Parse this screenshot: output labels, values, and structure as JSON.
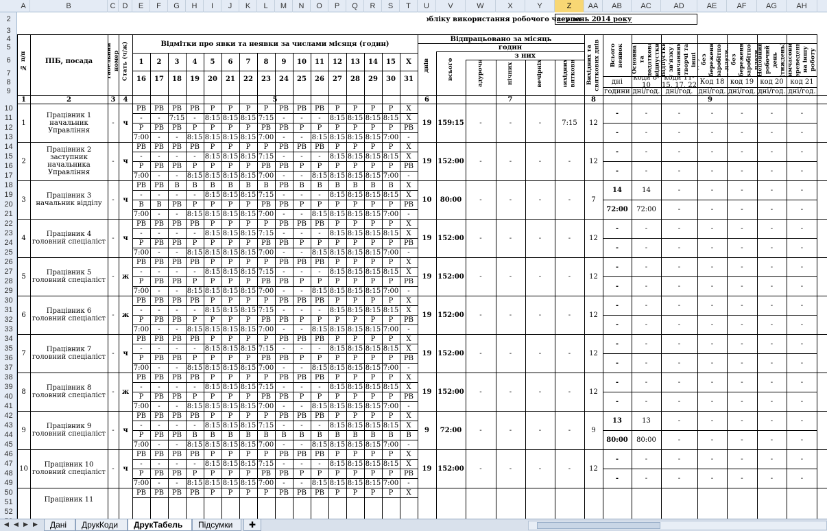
{
  "columns": [
    "A",
    "B",
    "C",
    "D",
    "E",
    "F",
    "G",
    "H",
    "I",
    "J",
    "K",
    "L",
    "M",
    "N",
    "O",
    "P",
    "Q",
    "R",
    "S",
    "T",
    "U",
    "V",
    "W",
    "X",
    "Y",
    "Z",
    "AA",
    "AB",
    "AC",
    "AD",
    "AE",
    "AF",
    "AG",
    "AH"
  ],
  "selected_column": "Z",
  "header": {
    "title_text": "обліку використання робочого часу за",
    "period": "серпень 2014 року",
    "no_label": "№ п/п",
    "name_label": "ПІБ, посада",
    "tab_label": "Табельний номер",
    "sex_label": "Стать (ч/ж)",
    "marks_label": "Відмітки  про явки та неявки за числами місяця (годин)",
    "days_top": [
      "1",
      "2",
      "3",
      "4",
      "5",
      "6",
      "7",
      "8",
      "9",
      "10",
      "11",
      "12",
      "13",
      "14",
      "15",
      "X"
    ],
    "days_bottom": [
      "16",
      "17",
      "18",
      "19",
      "20",
      "21",
      "22",
      "23",
      "24",
      "25",
      "26",
      "27",
      "28",
      "29",
      "30",
      "31"
    ],
    "worked_label": "Відпрацьовано за місяць",
    "hours_label": "годин",
    "of_them_label": "з них",
    "days_label": "днів",
    "total_label": "всього",
    "overtime_label": "надурочно",
    "night_label": "нічних",
    "evening_label": "вечірніх",
    "holiday_label": "вихідних, святкових",
    "holiday_days_label": "Вихідних та святкових днів",
    "total_absence_label": "Всього неявок",
    "reasons_label": "з причин за",
    "ab_days": "дні",
    "ab_hours": "години",
    "ac_text": "Основна та додаткова відпустки",
    "ac_code": "коди 8-10",
    "ac_unit": "дні/год.",
    "ad_text": "Відпустки у зв'язку з навчанням, творчі та інші",
    "ad_code": "коди 11-15, 17, 22",
    "ad_unit": "дні/год.",
    "ae_text": "Відпустки без збереження заробітної плати",
    "ae_code": "Код 18",
    "ae_unit": "дні/год.",
    "af_text": "Відпустки без збереження заробітної плати",
    "af_code": "код 19",
    "af_unit": "дні/год.",
    "ag_text": "Неповний робочий день (тиждень)",
    "ag_code": "код 20",
    "ag_unit": "дні/год.",
    "ah_text": "Тимчасовий переведення на іншу роботу",
    "ah_code": "код 21",
    "ah_unit": "дні/год.",
    "num_row": [
      "1",
      "2",
      "3",
      "4",
      "5",
      "6",
      "7",
      "8",
      "9"
    ]
  },
  "rows_top": [
    "1",
    "2",
    "3",
    "4",
    "5",
    "6",
    "7",
    "8",
    "9"
  ],
  "employees": [
    {
      "no": "1",
      "name": "Працівник 1",
      "pos": "начальник Управління",
      "sex": "ч",
      "tab": "-",
      "r1": [
        "РВ",
        "РВ",
        "РВ",
        "РВ",
        "Р",
        "Р",
        "Р",
        "Р",
        "РВ",
        "РВ",
        "РВ",
        "Р",
        "Р",
        "Р",
        "Р",
        "Х"
      ],
      "r2": [
        "-",
        "-",
        "7:15",
        "-",
        "8:15",
        "8:15",
        "8:15",
        "7:15",
        "-",
        "-",
        "-",
        "8:15",
        "8:15",
        "8:15",
        "8:15",
        "Х"
      ],
      "r3": [
        "Р",
        "РВ",
        "РВ",
        "Р",
        "Р",
        "Р",
        "Р",
        "РВ",
        "РВ",
        "Р",
        "Р",
        "Р",
        "Р",
        "Р",
        "Р",
        "РВ"
      ],
      "r4": [
        "7:00",
        "-",
        "-",
        "8:15",
        "8:15",
        "8:15",
        "8:15",
        "7:00",
        "-",
        "-",
        "8:15",
        "8:15",
        "8:15",
        "8:15",
        "7:00",
        "-"
      ],
      "days": "19",
      "total": "159:15",
      "ot": "-",
      "night": "-",
      "eve": "-",
      "hol": "7:15",
      "hold": "12",
      "abd": "-",
      "abh": "-",
      "acd": "-",
      "ach": "-"
    },
    {
      "no": "2",
      "name": "Працівник 2",
      "pos": "заступник начальника Управління",
      "sex": "ч",
      "tab": "-",
      "r1": [
        "РВ",
        "РВ",
        "РВ",
        "РВ",
        "Р",
        "Р",
        "Р",
        "Р",
        "РВ",
        "РВ",
        "РВ",
        "Р",
        "Р",
        "Р",
        "Р",
        "Х"
      ],
      "r2": [
        "-",
        "-",
        "-",
        "-",
        "8:15",
        "8:15",
        "8:15",
        "7:15",
        "-",
        "-",
        "-",
        "8:15",
        "8:15",
        "8:15",
        "8:15",
        "Х"
      ],
      "r3": [
        "Р",
        "РВ",
        "РВ",
        "Р",
        "Р",
        "Р",
        "Р",
        "РВ",
        "РВ",
        "Р",
        "Р",
        "Р",
        "Р",
        "Р",
        "Р",
        "РВ"
      ],
      "r4": [
        "7:00",
        "-",
        "-",
        "8:15",
        "8:15",
        "8:15",
        "8:15",
        "7:00",
        "-",
        "-",
        "8:15",
        "8:15",
        "8:15",
        "8:15",
        "7:00",
        "-"
      ],
      "days": "19",
      "total": "152:00",
      "ot": "-",
      "night": "-",
      "eve": "-",
      "hol": "-",
      "hold": "12",
      "abd": "-",
      "abh": "-",
      "acd": "-",
      "ach": "-"
    },
    {
      "no": "3",
      "name": "Працівник 3",
      "pos": "начальник відділу",
      "sex": "ч",
      "tab": "-",
      "r1": [
        "РВ",
        "РВ",
        "В",
        "В",
        "В",
        "В",
        "В",
        "В",
        "РВ",
        "В",
        "В",
        "В",
        "В",
        "В",
        "В",
        "Х"
      ],
      "r2": [
        "-",
        "-",
        "-",
        "-",
        "8:15",
        "8:15",
        "8:15",
        "7:15",
        "-",
        "-",
        "-",
        "8:15",
        "8:15",
        "8:15",
        "8:15",
        "Х"
      ],
      "r3": [
        "В",
        "В",
        "РВ",
        "Р",
        "Р",
        "Р",
        "Р",
        "РВ",
        "РВ",
        "Р",
        "Р",
        "Р",
        "Р",
        "Р",
        "Р",
        "РВ"
      ],
      "r4": [
        "7:00",
        "-",
        "-",
        "8:15",
        "8:15",
        "8:15",
        "8:15",
        "7:00",
        "-",
        "-",
        "8:15",
        "8:15",
        "8:15",
        "8:15",
        "7:00",
        "-"
      ],
      "days": "10",
      "total": "80:00",
      "ot": "-",
      "night": "-",
      "eve": "-",
      "hol": "-",
      "hold": "7",
      "abd": "14",
      "abh": "72:00",
      "acd": "14",
      "ach": "72:00"
    },
    {
      "no": "4",
      "name": "Працівник 4",
      "pos": "головний спеціаліст",
      "sex": "ч",
      "tab": "-",
      "r1": [
        "РВ",
        "РВ",
        "РВ",
        "РВ",
        "Р",
        "Р",
        "Р",
        "Р",
        "РВ",
        "РВ",
        "РВ",
        "Р",
        "Р",
        "Р",
        "Р",
        "Х"
      ],
      "r2": [
        "-",
        "-",
        "-",
        "-",
        "8:15",
        "8:15",
        "8:15",
        "7:15",
        "-",
        "-",
        "-",
        "8:15",
        "8:15",
        "8:15",
        "8:15",
        "Х"
      ],
      "r3": [
        "Р",
        "РВ",
        "РВ",
        "Р",
        "Р",
        "Р",
        "Р",
        "РВ",
        "РВ",
        "Р",
        "Р",
        "Р",
        "Р",
        "Р",
        "Р",
        "РВ"
      ],
      "r4": [
        "7:00",
        "-",
        "-",
        "8:15",
        "8:15",
        "8:15",
        "8:15",
        "7:00",
        "-",
        "-",
        "8:15",
        "8:15",
        "8:15",
        "8:15",
        "7:00",
        "-"
      ],
      "days": "19",
      "total": "152:00",
      "ot": "-",
      "night": "-",
      "eve": "-",
      "hol": "-",
      "hold": "12",
      "abd": "-",
      "abh": "-",
      "acd": "-",
      "ach": "-"
    },
    {
      "no": "5",
      "name": "Працівник 5",
      "pos": "головний спеціаліст",
      "sex": "ж",
      "tab": "-",
      "r1": [
        "РВ",
        "РВ",
        "РВ",
        "РВ",
        "Р",
        "Р",
        "Р",
        "Р",
        "РВ",
        "РВ",
        "РВ",
        "Р",
        "Р",
        "Р",
        "Р",
        "Х"
      ],
      "r2": [
        "-",
        "-",
        "-",
        "-",
        "8:15",
        "8:15",
        "8:15",
        "7:15",
        "-",
        "-",
        "-",
        "8:15",
        "8:15",
        "8:15",
        "8:15",
        "Х"
      ],
      "r3": [
        "Р",
        "РВ",
        "РВ",
        "Р",
        "Р",
        "Р",
        "Р",
        "РВ",
        "РВ",
        "Р",
        "Р",
        "Р",
        "Р",
        "Р",
        "Р",
        "РВ"
      ],
      "r4": [
        "7:00",
        "-",
        "-",
        "8:15",
        "8:15",
        "8:15",
        "8:15",
        "7:00",
        "-",
        "-",
        "8:15",
        "8:15",
        "8:15",
        "8:15",
        "7:00",
        "-"
      ],
      "days": "19",
      "total": "152:00",
      "ot": "-",
      "night": "-",
      "eve": "-",
      "hol": "-",
      "hold": "12",
      "abd": "-",
      "abh": "-",
      "acd": "-",
      "ach": "-"
    },
    {
      "no": "6",
      "name": "Працівник 6",
      "pos": "головний спеціаліст",
      "sex": "ж",
      "tab": "-",
      "r1": [
        "РВ",
        "РВ",
        "РВ",
        "РВ",
        "Р",
        "Р",
        "Р",
        "Р",
        "РВ",
        "РВ",
        "РВ",
        "Р",
        "Р",
        "Р",
        "Р",
        "Х"
      ],
      "r2": [
        "-",
        "-",
        "-",
        "-",
        "8:15",
        "8:15",
        "8:15",
        "7:15",
        "-",
        "-",
        "-",
        "8:15",
        "8:15",
        "8:15",
        "8:15",
        "Х"
      ],
      "r3": [
        "Р",
        "РВ",
        "РВ",
        "Р",
        "Р",
        "Р",
        "Р",
        "РВ",
        "РВ",
        "Р",
        "Р",
        "Р",
        "Р",
        "Р",
        "Р",
        "РВ"
      ],
      "r4": [
        "7:00",
        "-",
        "-",
        "8:15",
        "8:15",
        "8:15",
        "8:15",
        "7:00",
        "-",
        "-",
        "8:15",
        "8:15",
        "8:15",
        "8:15",
        "7:00",
        "-"
      ],
      "days": "19",
      "total": "152:00",
      "ot": "-",
      "night": "-",
      "eve": "-",
      "hol": "-",
      "hold": "12",
      "abd": "-",
      "abh": "-",
      "acd": "-",
      "ach": "-"
    },
    {
      "no": "7",
      "name": "Працівник 7",
      "pos": "головний спеціаліст",
      "sex": "ч",
      "tab": "-",
      "r1": [
        "РВ",
        "РВ",
        "РВ",
        "РВ",
        "Р",
        "Р",
        "Р",
        "Р",
        "РВ",
        "РВ",
        "РВ",
        "Р",
        "Р",
        "Р",
        "Р",
        "Х"
      ],
      "r2": [
        "-",
        "-",
        "-",
        "-",
        "8:15",
        "8:15",
        "8:15",
        "7:15",
        "-",
        "-",
        "-",
        "8:15",
        "8:15",
        "8:15",
        "8:15",
        "Х"
      ],
      "r3": [
        "Р",
        "РВ",
        "РВ",
        "Р",
        "Р",
        "Р",
        "Р",
        "РВ",
        "РВ",
        "Р",
        "Р",
        "Р",
        "Р",
        "Р",
        "Р",
        "РВ"
      ],
      "r4": [
        "7:00",
        "-",
        "-",
        "8:15",
        "8:15",
        "8:15",
        "8:15",
        "7:00",
        "-",
        "-",
        "8:15",
        "8:15",
        "8:15",
        "8:15",
        "7:00",
        "-"
      ],
      "days": "19",
      "total": "152:00",
      "ot": "-",
      "night": "-",
      "eve": "-",
      "hol": "-",
      "hold": "12",
      "abd": "-",
      "abh": "-",
      "acd": "-",
      "ach": "-"
    },
    {
      "no": "8",
      "name": "Працівник 8",
      "pos": "головний спеціаліст",
      "sex": "ж",
      "tab": "-",
      "r1": [
        "РВ",
        "РВ",
        "РВ",
        "РВ",
        "Р",
        "Р",
        "Р",
        "Р",
        "РВ",
        "РВ",
        "РВ",
        "Р",
        "Р",
        "Р",
        "Р",
        "Х"
      ],
      "r2": [
        "-",
        "-",
        "-",
        "-",
        "8:15",
        "8:15",
        "8:15",
        "7:15",
        "-",
        "-",
        "-",
        "8:15",
        "8:15",
        "8:15",
        "8:15",
        "Х"
      ],
      "r3": [
        "Р",
        "РВ",
        "РВ",
        "Р",
        "Р",
        "Р",
        "Р",
        "РВ",
        "РВ",
        "Р",
        "Р",
        "Р",
        "Р",
        "Р",
        "Р",
        "РВ"
      ],
      "r4": [
        "7:00",
        "-",
        "-",
        "8:15",
        "8:15",
        "8:15",
        "8:15",
        "7:00",
        "-",
        "-",
        "8:15",
        "8:15",
        "8:15",
        "8:15",
        "7:00",
        "-"
      ],
      "days": "19",
      "total": "152:00",
      "ot": "-",
      "night": "-",
      "eve": "-",
      "hol": "-",
      "hold": "12",
      "abd": "-",
      "abh": "-",
      "acd": "-",
      "ach": "-"
    },
    {
      "no": "9",
      "name": "Працівник 9",
      "pos": "головний спеціаліст",
      "sex": "ч",
      "tab": "-",
      "r1": [
        "РВ",
        "РВ",
        "РВ",
        "РВ",
        "Р",
        "Р",
        "Р",
        "Р",
        "РВ",
        "РВ",
        "РВ",
        "Р",
        "Р",
        "Р",
        "Р",
        "Х"
      ],
      "r2": [
        "-",
        "-",
        "-",
        "-",
        "8:15",
        "8:15",
        "8:15",
        "7:15",
        "-",
        "-",
        "-",
        "8:15",
        "8:15",
        "8:15",
        "8:15",
        "Х"
      ],
      "r3": [
        "Р",
        "РВ",
        "РВ",
        "В",
        "В",
        "В",
        "В",
        "В",
        "В",
        "В",
        "В",
        "В",
        "В",
        "В",
        "В",
        "В"
      ],
      "r4": [
        "7:00",
        "-",
        "-",
        "8:15",
        "8:15",
        "8:15",
        "8:15",
        "7:00",
        "-",
        "-",
        "8:15",
        "8:15",
        "8:15",
        "8:15",
        "7:00",
        "-"
      ],
      "days": "9",
      "total": "72:00",
      "ot": "-",
      "night": "-",
      "eve": "-",
      "hol": "-",
      "hold": "9",
      "abd": "13",
      "abh": "80:00",
      "acd": "13",
      "ach": "80:00"
    },
    {
      "no": "10",
      "name": "Працівник 10",
      "pos": "головний спеціаліст",
      "sex": "ч",
      "tab": "-",
      "r1": [
        "РВ",
        "РВ",
        "РВ",
        "РВ",
        "Р",
        "Р",
        "Р",
        "Р",
        "РВ",
        "РВ",
        "РВ",
        "Р",
        "Р",
        "Р",
        "Р",
        "Х"
      ],
      "r2": [
        "-",
        "-",
        "-",
        "-",
        "8:15",
        "8:15",
        "8:15",
        "7:15",
        "-",
        "-",
        "-",
        "8:15",
        "8:15",
        "8:15",
        "8:15",
        "Х"
      ],
      "r3": [
        "Р",
        "РВ",
        "РВ",
        "Р",
        "Р",
        "Р",
        "Р",
        "РВ",
        "РВ",
        "Р",
        "Р",
        "Р",
        "Р",
        "Р",
        "Р",
        "РВ"
      ],
      "r4": [
        "7:00",
        "-",
        "-",
        "8:15",
        "8:15",
        "8:15",
        "8:15",
        "7:00",
        "-",
        "-",
        "8:15",
        "8:15",
        "8:15",
        "8:15",
        "7:00",
        "-"
      ],
      "days": "19",
      "total": "152:00",
      "ot": "-",
      "night": "-",
      "eve": "-",
      "hol": "-",
      "hold": "12",
      "abd": "-",
      "abh": "-",
      "acd": "-",
      "ach": "-"
    }
  ],
  "partial": {
    "name": "Працівник 11",
    "r1": [
      "РВ",
      "РВ",
      "РВ",
      "РВ",
      "Р",
      "Р",
      "Р",
      "Р",
      "РВ",
      "РВ",
      "РВ",
      "Р",
      "Р",
      "Р",
      "Р",
      "Х"
    ]
  },
  "tabs": [
    "Дані",
    "ДрукКоди",
    "ДрукТабель",
    "Підсумки"
  ],
  "active_tab": "ДрукТабель"
}
